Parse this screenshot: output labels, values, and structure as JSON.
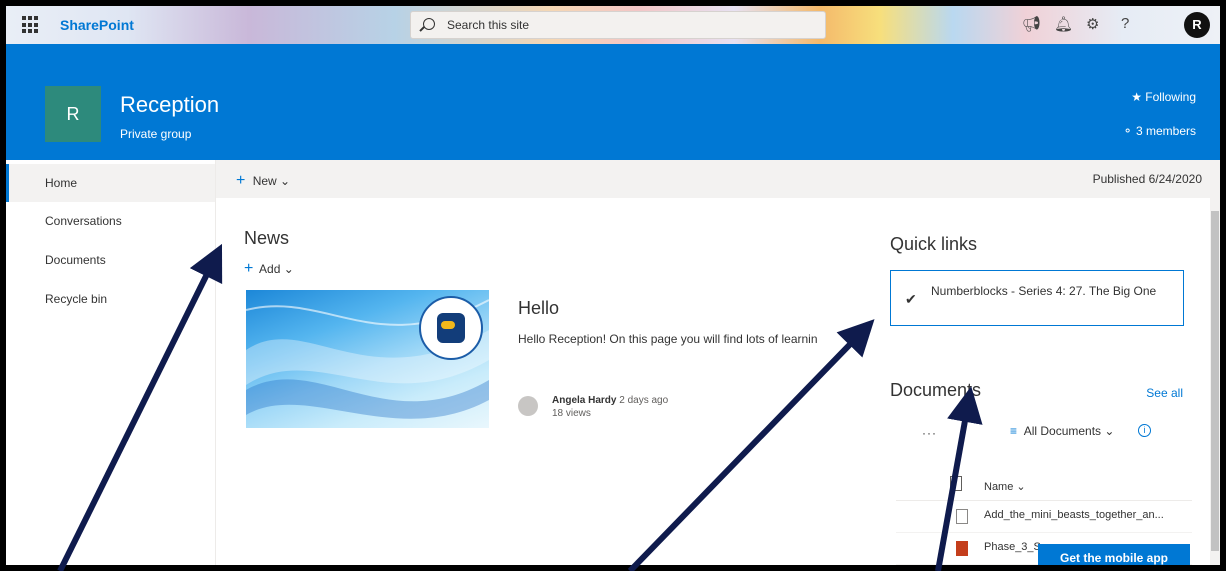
{
  "suitebar": {
    "app_name": "SharePoint",
    "search_placeholder": "Search this site",
    "icons": [
      "waffle-icon",
      "megaphone-icon",
      "bell-icon",
      "gear-icon",
      "help-icon"
    ],
    "avatar_initial": "R"
  },
  "site": {
    "logo_letter": "R",
    "title": "Reception",
    "subtitle": "Private group",
    "following_label": "Following",
    "members_label": "3 members"
  },
  "nav": {
    "items": [
      {
        "label": "Home",
        "active": true
      },
      {
        "label": "Conversations",
        "active": false
      },
      {
        "label": "Documents",
        "active": false
      },
      {
        "label": "Recycle bin",
        "active": false
      }
    ]
  },
  "commandbar": {
    "new_label": "New",
    "published_label": "Published 6/24/2020"
  },
  "news": {
    "heading": "News",
    "add_label": "Add",
    "item": {
      "title": "Hello",
      "description": "Hello Reception! On this page you will find lots of learnin",
      "author": "Angela Hardy",
      "time": "2 days ago",
      "views": "18 views"
    }
  },
  "quicklinks": {
    "heading": "Quick links",
    "items": [
      "Numberblocks - Series 4: 27. The Big One"
    ]
  },
  "documents": {
    "heading": "Documents",
    "see_all": "See all",
    "more": "···",
    "view": "All Documents",
    "column_name": "Name",
    "files": [
      {
        "name": "Add_the_mini_beasts_together_an...",
        "type": "doc"
      },
      {
        "name": "Phase_3_Se",
        "type": "ppt"
      }
    ]
  },
  "mobile_app_label": "Get the mobile app",
  "colors": {
    "brand_blue": "#0078d4",
    "logo_teal": "#2d8a7c",
    "annotation_navy": "#0f1b4d"
  }
}
